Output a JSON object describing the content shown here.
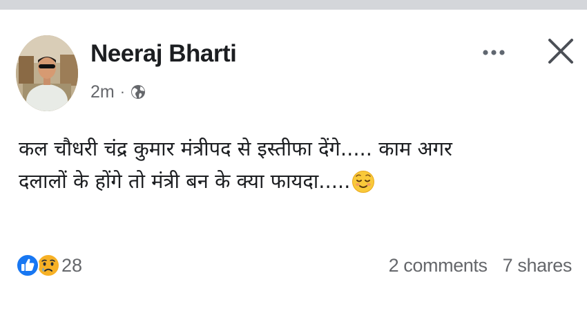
{
  "post": {
    "author_name": "Neeraj Bharti",
    "timestamp": "2m",
    "separator": "·",
    "audience_icon": "globe-icon",
    "text_lines": [
      "कल चौधरी चंद्र कुमार मंत्रीपद से इस्तीफा देंगे..... काम अगर",
      "दलालों के होंगे तो मंत्री बन के क्या फायदा....."
    ],
    "emoji": "relieved-face-emoji"
  },
  "actions": {
    "more_icon": "more-dots-icon",
    "close_icon": "close-icon"
  },
  "reactions": {
    "icons": [
      "like-icon",
      "sad-icon"
    ],
    "count": "28"
  },
  "stats": {
    "comments": "2 comments",
    "shares": "7 shares"
  },
  "colors": {
    "like_blue": "#1877f2",
    "sad_yellow": "#f7b125",
    "secondary_text": "#65676b",
    "top_bar": "#d4d6da"
  }
}
